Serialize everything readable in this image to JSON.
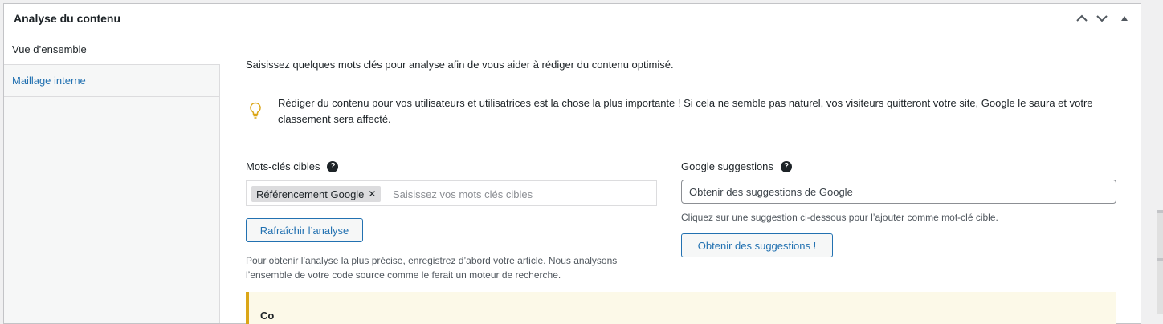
{
  "panel": {
    "title": "Analyse du contenu",
    "controls": [
      "chevron-up-icon",
      "chevron-down-icon",
      "triangle-up-icon"
    ]
  },
  "sidebar": {
    "items": [
      {
        "label": "Vue d’ensemble",
        "active": true
      },
      {
        "label": "Maillage interne",
        "active": false
      }
    ]
  },
  "main": {
    "intro": "Saisissez quelques mots clés pour analyse afin de vous aider à rédiger du contenu optimisé.",
    "tip": "Rédiger du contenu pour vos utilisateurs et utilisatrices est la chose la plus importante ! Si cela ne semble pas naturel, vos visiteurs quitteront votre site, Google le saura et votre classement sera affecté.",
    "keywords": {
      "label": "Mots-clés cibles",
      "tags": [
        "Référencement Google"
      ],
      "placeholder": "Saisissez vos mots clés cibles",
      "refresh_button": "Rafraîchir l’analyse",
      "note": "Pour obtenir l’analyse la plus précise, enregistrez d’abord votre article. Nous analysons l’ensemble de votre code source comme le ferait un moteur de recherche."
    },
    "google": {
      "label": "Google suggestions",
      "placeholder": "Obtenir des suggestions de Google",
      "hint": "Cliquez sur une suggestion ci-dessous pour l’ajouter comme mot-clé cible.",
      "button": "Obtenir des suggestions !"
    },
    "warning": {
      "text": "Co"
    }
  },
  "colors": {
    "accent": "#2271b1",
    "tip_icon": "#dba617",
    "warning_bg": "#fcf9e8"
  }
}
